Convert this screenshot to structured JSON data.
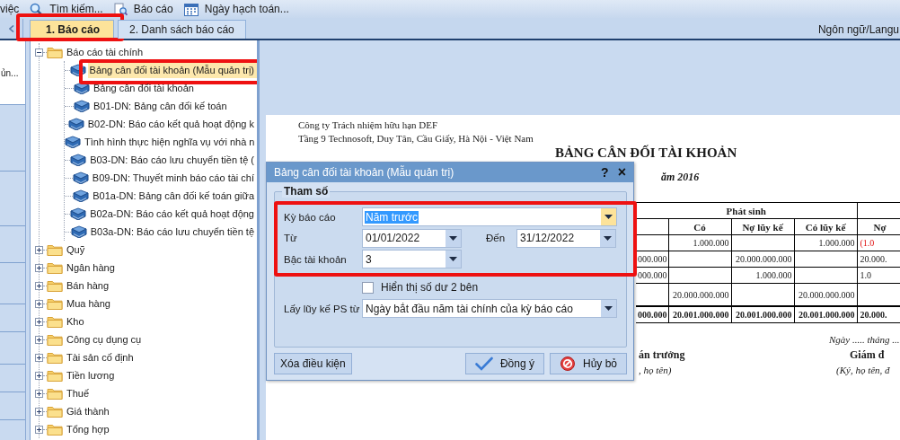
{
  "toolbar": {
    "lead_text": "việc",
    "items": [
      {
        "label": "Tìm kiếm..."
      },
      {
        "label": "Báo cáo"
      },
      {
        "label": "Ngày hạch toán..."
      }
    ]
  },
  "tabs": [
    {
      "label": "1. Báo cáo",
      "selected": true,
      "highlighted": true
    },
    {
      "label": "2. Danh sách báo cáo",
      "selected": false,
      "highlighted": false
    }
  ],
  "language_label": "Ngôn ngữ/Langu",
  "nav_pane": {
    "text": "ủn..."
  },
  "tree": [
    {
      "label": "Báo cáo tài chính",
      "expanded": true,
      "children": [
        {
          "label": "Bảng cân đối tài khoản (Mẫu quản trị)",
          "selected": true,
          "highlighted": true
        },
        {
          "label": "Bảng cân đối tài khoản",
          "selected": false,
          "highlighted": false
        },
        {
          "label": "B01-DN: Bảng cân đối kế toán",
          "selected": false,
          "highlighted": false
        },
        {
          "label": "B02-DN: Báo cáo kết quả hoạt động k",
          "selected": false,
          "highlighted": false
        },
        {
          "label": "Tình hình thực hiện nghĩa vụ với nhà n",
          "selected": false,
          "highlighted": false
        },
        {
          "label": "B03-DN: Báo cáo lưu chuyển tiền tệ (",
          "selected": false,
          "highlighted": false
        },
        {
          "label": "B09-DN: Thuyết minh báo cáo tài chí",
          "selected": false,
          "highlighted": false
        },
        {
          "label": "B01a-DN: Bảng cân đối kế toán giữa",
          "selected": false,
          "highlighted": false
        },
        {
          "label": "B02a-DN: Báo cáo kết quả hoạt động",
          "selected": false,
          "highlighted": false
        },
        {
          "label": "B03a-DN: Báo cáo lưu chuyển tiền tệ",
          "selected": false,
          "highlighted": false
        }
      ]
    },
    {
      "label": "Quỹ",
      "expanded": false
    },
    {
      "label": "Ngân hàng",
      "expanded": false
    },
    {
      "label": "Bán hàng",
      "expanded": false
    },
    {
      "label": "Mua hàng",
      "expanded": false
    },
    {
      "label": "Kho",
      "expanded": false
    },
    {
      "label": "Công cụ dụng cụ",
      "expanded": false
    },
    {
      "label": "Tài sản cố định",
      "expanded": false
    },
    {
      "label": "Tiền lương",
      "expanded": false
    },
    {
      "label": "Thuế",
      "expanded": false
    },
    {
      "label": "Giá thành",
      "expanded": false
    },
    {
      "label": "Tổng hợp",
      "expanded": false
    }
  ],
  "report": {
    "company": "Công ty Trách nhiệm hữu hạn DEF",
    "address": "Tầng 9 Technosoft, Duy Tân, Cầu Giấy, Hà Nội - Việt Nam",
    "title": "BẢNG CÂN ĐỐI TÀI KHOẢN",
    "subtitle": "ăm 2016",
    "table": {
      "group_header": "Phát sinh",
      "column_headers": [
        "Có",
        "Nợ lũy kế",
        "Có lũy kế",
        "Nợ"
      ],
      "rows": [
        {
          "total": false,
          "cells": [
            null,
            "1.000.000",
            null,
            "1.000.000",
            {
              "text": "(1.0",
              "negative": true
            }
          ]
        },
        {
          "total": false,
          "cells": [
            "000.000",
            null,
            "20.000.000.000",
            null,
            "20.000."
          ]
        },
        {
          "total": false,
          "cells": [
            "000.000",
            null,
            "1.000.000",
            null,
            "1.0"
          ]
        },
        {
          "total": false,
          "cells": [
            null,
            "20.000.000.000",
            null,
            "20.000.000.000",
            null
          ]
        },
        {
          "total": true,
          "cells": [
            "000.000",
            "20.001.000.000",
            "20.001.000.000",
            "20.001.000.000",
            "20.000."
          ]
        }
      ]
    },
    "date_line": "Ngày ..... tháng ...",
    "signers": [
      {
        "title": "án trưởng",
        "note": ", họ tên)"
      },
      {
        "title": "Giám đ",
        "note": "(Ký, họ tên, đ"
      }
    ]
  },
  "dialog": {
    "title": "Bảng cân đối tài khoản (Mẫu quản trị)",
    "help": "?",
    "close": "×",
    "group_title": "Tham số",
    "sections": [
      {
        "highlighted": true,
        "rows": [
          {
            "fields": [
              {
                "kind": "combo",
                "label": "Kỳ báo cáo",
                "value": "Năm trước",
                "focused": true
              }
            ]
          },
          {
            "fields": [
              {
                "kind": "date",
                "label": "Từ",
                "value": "01/01/2022",
                "focused": false
              },
              {
                "kind": "date",
                "label": "Đến",
                "value": "31/12/2022",
                "focused": false
              }
            ]
          },
          {
            "fields": [
              {
                "kind": "picker",
                "label": "Bậc tài khoản",
                "value": "3",
                "focused": false
              }
            ]
          }
        ]
      },
      {
        "highlighted": false,
        "rows": [
          {
            "fields": [
              {
                "kind": "checkbox",
                "label": "Hiển thị số dư 2 bên",
                "checked": false
              }
            ]
          },
          {
            "fields": [
              {
                "kind": "combo",
                "label": "Lấy lũy kế PS từ",
                "value": "Ngày bắt đầu năm tài chính của kỳ báo cáo",
                "focused": false
              }
            ]
          }
        ]
      }
    ],
    "buttons": [
      {
        "label": "Xóa điều kiện"
      },
      {
        "label": "Đồng ý"
      },
      {
        "label": "Hủy bỏ"
      }
    ]
  }
}
